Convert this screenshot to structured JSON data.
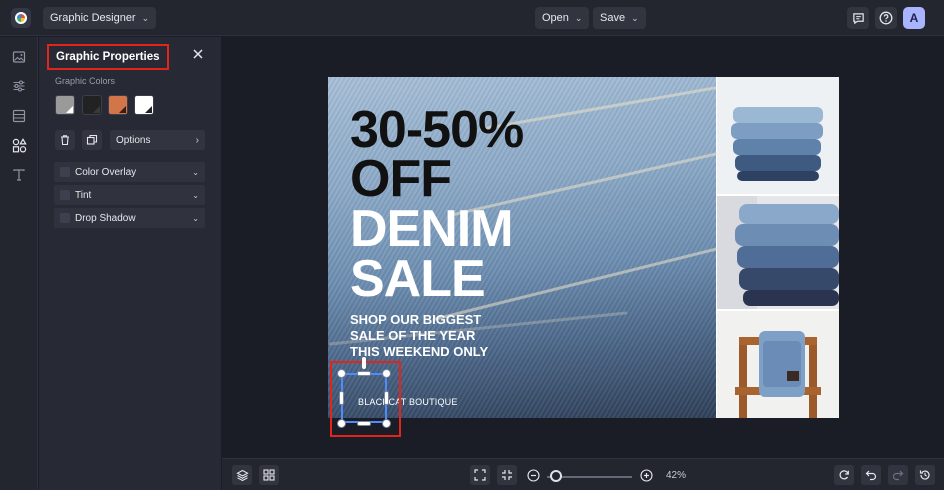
{
  "topbar": {
    "app_menu_label": "Graphic Designer",
    "open_label": "Open",
    "save_label": "Save",
    "avatar_initial": "A"
  },
  "panel": {
    "title": "Graphic Properties",
    "colors_label": "Graphic Colors",
    "swatches": [
      "#9a9a9a",
      "#222222",
      "#d2764a",
      "#ffffff"
    ],
    "options_label": "Options",
    "accordions": [
      {
        "label": "Color Overlay"
      },
      {
        "label": "Tint"
      },
      {
        "label": "Drop Shadow"
      }
    ]
  },
  "canvas": {
    "headline_1": "30-50%",
    "headline_2": "OFF",
    "headline_3": "DENIM",
    "headline_4": "SALE",
    "sub_1": "SHOP OUR BIGGEST",
    "sub_2": "SALE OF THE YEAR",
    "sub_3": "THIS WEEKEND ONLY",
    "boutique": "BLACKCAT BOUTIQUE"
  },
  "bottombar": {
    "zoom": "42%"
  },
  "colors": {
    "accent_red": "#e1251b",
    "selection_blue": "#4d8cff",
    "avatar": "#a9b4ff"
  }
}
